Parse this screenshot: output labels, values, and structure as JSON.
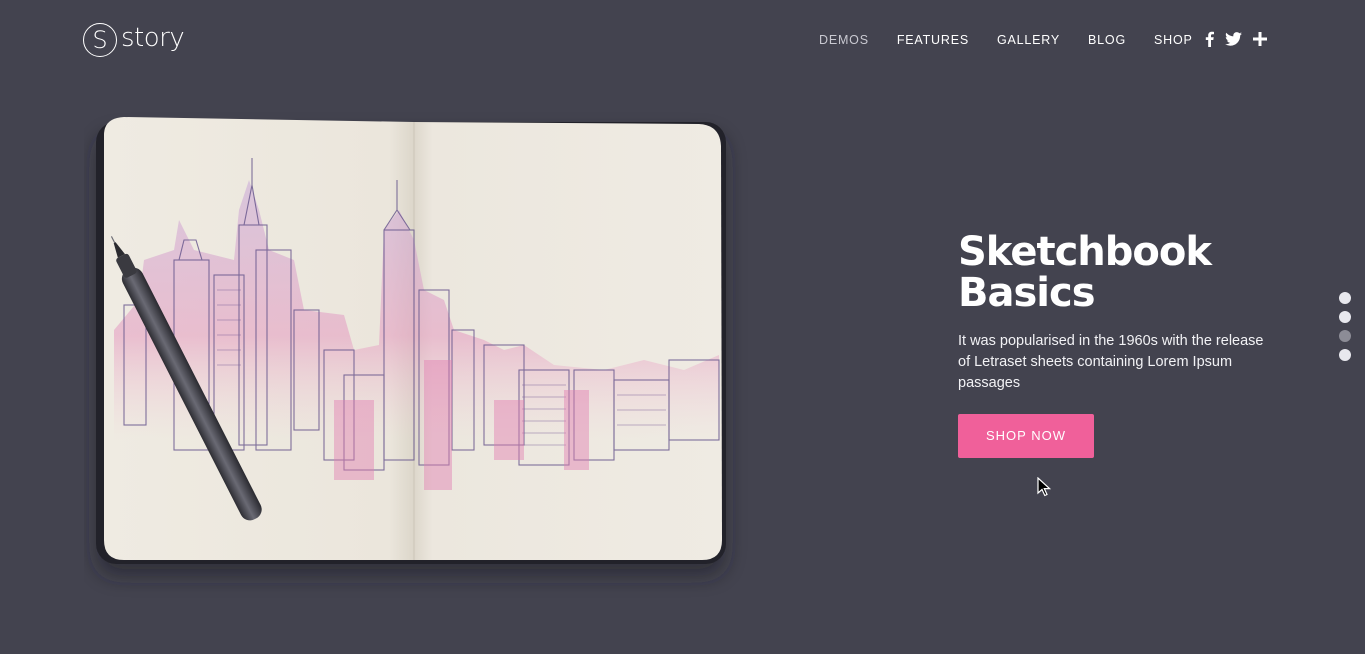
{
  "brand": {
    "logo_letter": "S",
    "logo_text": "story"
  },
  "nav": {
    "items": [
      {
        "label": "DEMOS"
      },
      {
        "label": "FEATURES"
      },
      {
        "label": "GALLERY"
      },
      {
        "label": "BLOG"
      },
      {
        "label": "SHOP"
      }
    ],
    "active_label": "DEMOS"
  },
  "social": {
    "icons": [
      "facebook-icon",
      "twitter-icon",
      "plus-icon"
    ]
  },
  "hero": {
    "title": "Sketchbook\nBasics",
    "description": "It was popularised in the 1960s with the release of Letraset sheets containing Lorem Ipsum passages",
    "cta_label": "SHOP NOW"
  },
  "slider": {
    "dot_count": 4,
    "active_index": 2
  },
  "colors": {
    "background": "#43434f",
    "accent": "#f0609a"
  }
}
